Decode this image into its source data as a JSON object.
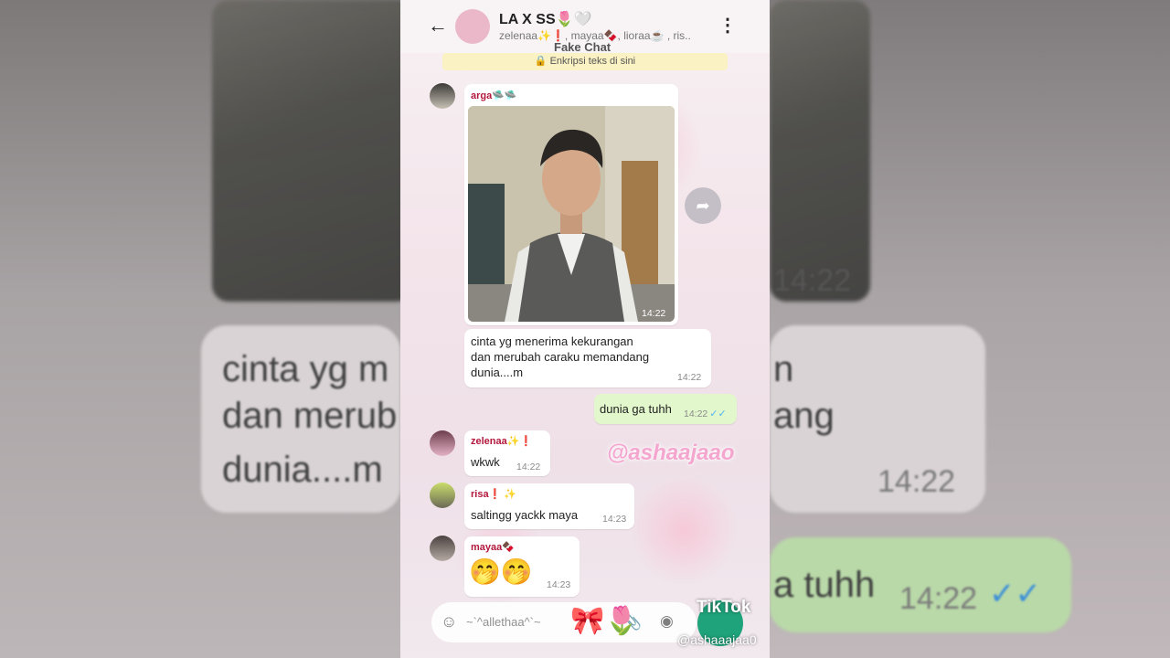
{
  "header": {
    "back_icon": "arrow-left-icon",
    "title": "LA X SS🌷🤍",
    "subtitle": "zelenaa✨❗, mayaa🍫, lioraa☕ , ris..",
    "menu_icon": "more-vertical-icon",
    "fake_chat": "Fake Chat",
    "notice": "🔒 Enkripsi teks di sini"
  },
  "messages": {
    "arga_photo": {
      "sender": "arga🛸🛸",
      "time": "14:22"
    },
    "arga_text": {
      "text": "cinta yg menerima kekurangan\ndan merubah caraku memandang\ndunia....m",
      "time": "14:22"
    },
    "out_1": {
      "text": "dunia ga tuhh",
      "time": "14:22",
      "ticks": "✓✓"
    },
    "zelenaa": {
      "sender": "zelenaa✨❗",
      "text": "wkwk",
      "time": "14:22"
    },
    "risa": {
      "sender": "risa❗ ✨",
      "text": "saltingg yackk maya",
      "time": "14:23"
    },
    "mayaa": {
      "sender": "mayaa🍫",
      "text": "🤭🤭",
      "time": "14:23"
    }
  },
  "input": {
    "placeholder": "~`^allethaa^`~",
    "emoji_icon": "smile-icon",
    "attach_icon": "paperclip-icon",
    "camera_icon": "camera-icon",
    "decor": "🎀🌷"
  },
  "forward_icon": "forward-icon",
  "watermark": {
    "handle": "@ashaajaao",
    "tiktok": "TikTok",
    "tiktok_handle": "@ashaaajaa0"
  },
  "background": {
    "line1": "cinta yg m",
    "line2": "dan merub",
    "line3": "dunia....m",
    "time_left": "14:22",
    "r_line1": "n",
    "r_line2": "ang",
    "r_time1": "14:22",
    "r_time2": "14:22",
    "r_text": "a tuhh",
    "r_ticks": "✓✓"
  }
}
